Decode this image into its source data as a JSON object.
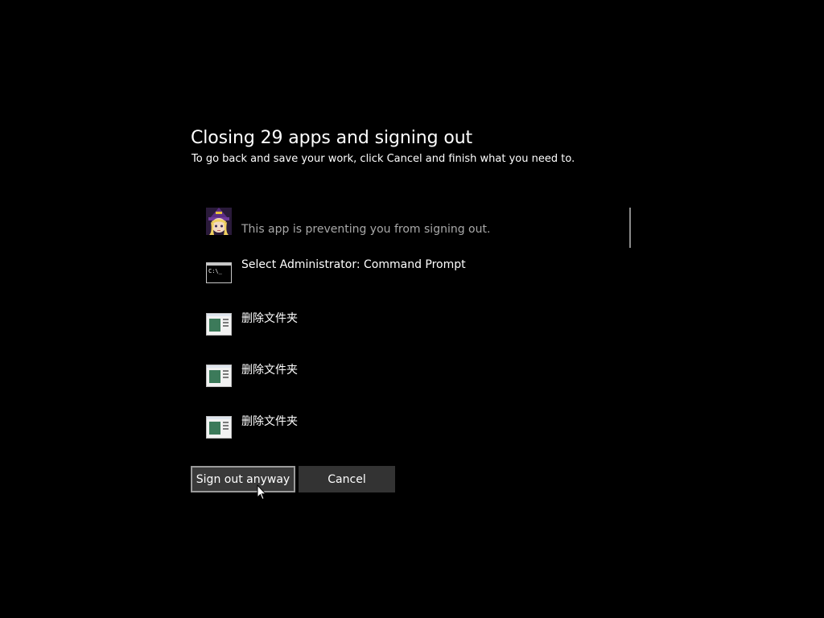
{
  "dialog": {
    "title": "Closing 29 apps and signing out",
    "subtitle": "To go back and save your work, click Cancel and finish what you need to."
  },
  "apps": [
    {
      "name": "",
      "status": "This app is preventing you from signing out.",
      "icon": "anime-avatar-icon"
    },
    {
      "name": "Select Administrator: Command Prompt",
      "icon": "command-prompt-icon"
    },
    {
      "name": "删除文件夹",
      "icon": "app-window-icon"
    },
    {
      "name": "删除文件夹",
      "icon": "app-window-icon"
    },
    {
      "name": "删除文件夹",
      "icon": "app-window-icon"
    }
  ],
  "buttons": {
    "sign_out": "Sign out anyway",
    "cancel": "Cancel"
  },
  "colors": {
    "background": "#000000",
    "text": "#ffffff",
    "muted_text": "#a8a8a8",
    "button_bg": "#333333",
    "button_focus_border": "#9a9a9a"
  }
}
